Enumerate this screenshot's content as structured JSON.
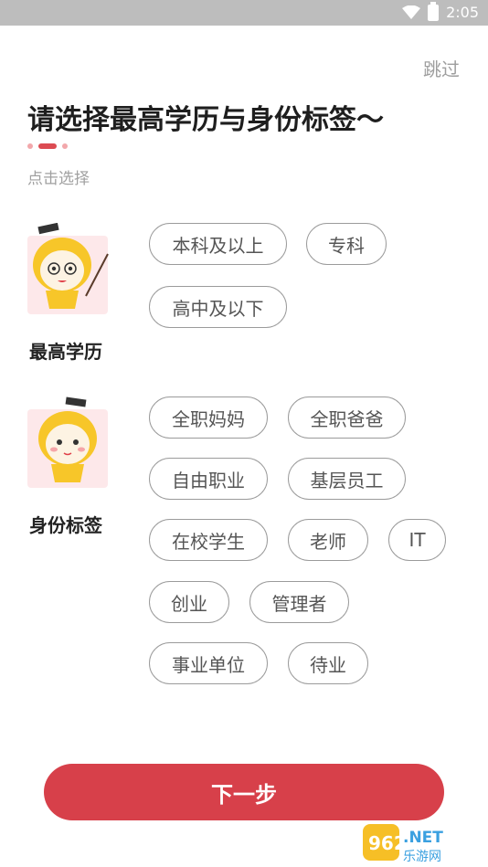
{
  "status_bar": {
    "time": "2:05"
  },
  "skip_label": "跳过",
  "title": "请选择最高学历与身份标签～",
  "hint": "点击选择",
  "education": {
    "label": "最高学历",
    "options": [
      "本科及以上",
      "专科",
      "高中及以下"
    ]
  },
  "identity": {
    "label": "身份标签",
    "options": [
      "全职妈妈",
      "全职爸爸",
      "自由职业",
      "基层员工",
      "在校学生",
      "老师",
      "IT",
      "创业",
      "管理者",
      "事业单位",
      "待业"
    ]
  },
  "next_button": "下一步",
  "watermark": {
    "top": "962.NET",
    "bottom": "乐游网"
  },
  "colors": {
    "accent": "#d7404a",
    "chip_border": "#9b9b9b",
    "chip_text": "#555555",
    "status_bar": "#bdbdbd"
  }
}
